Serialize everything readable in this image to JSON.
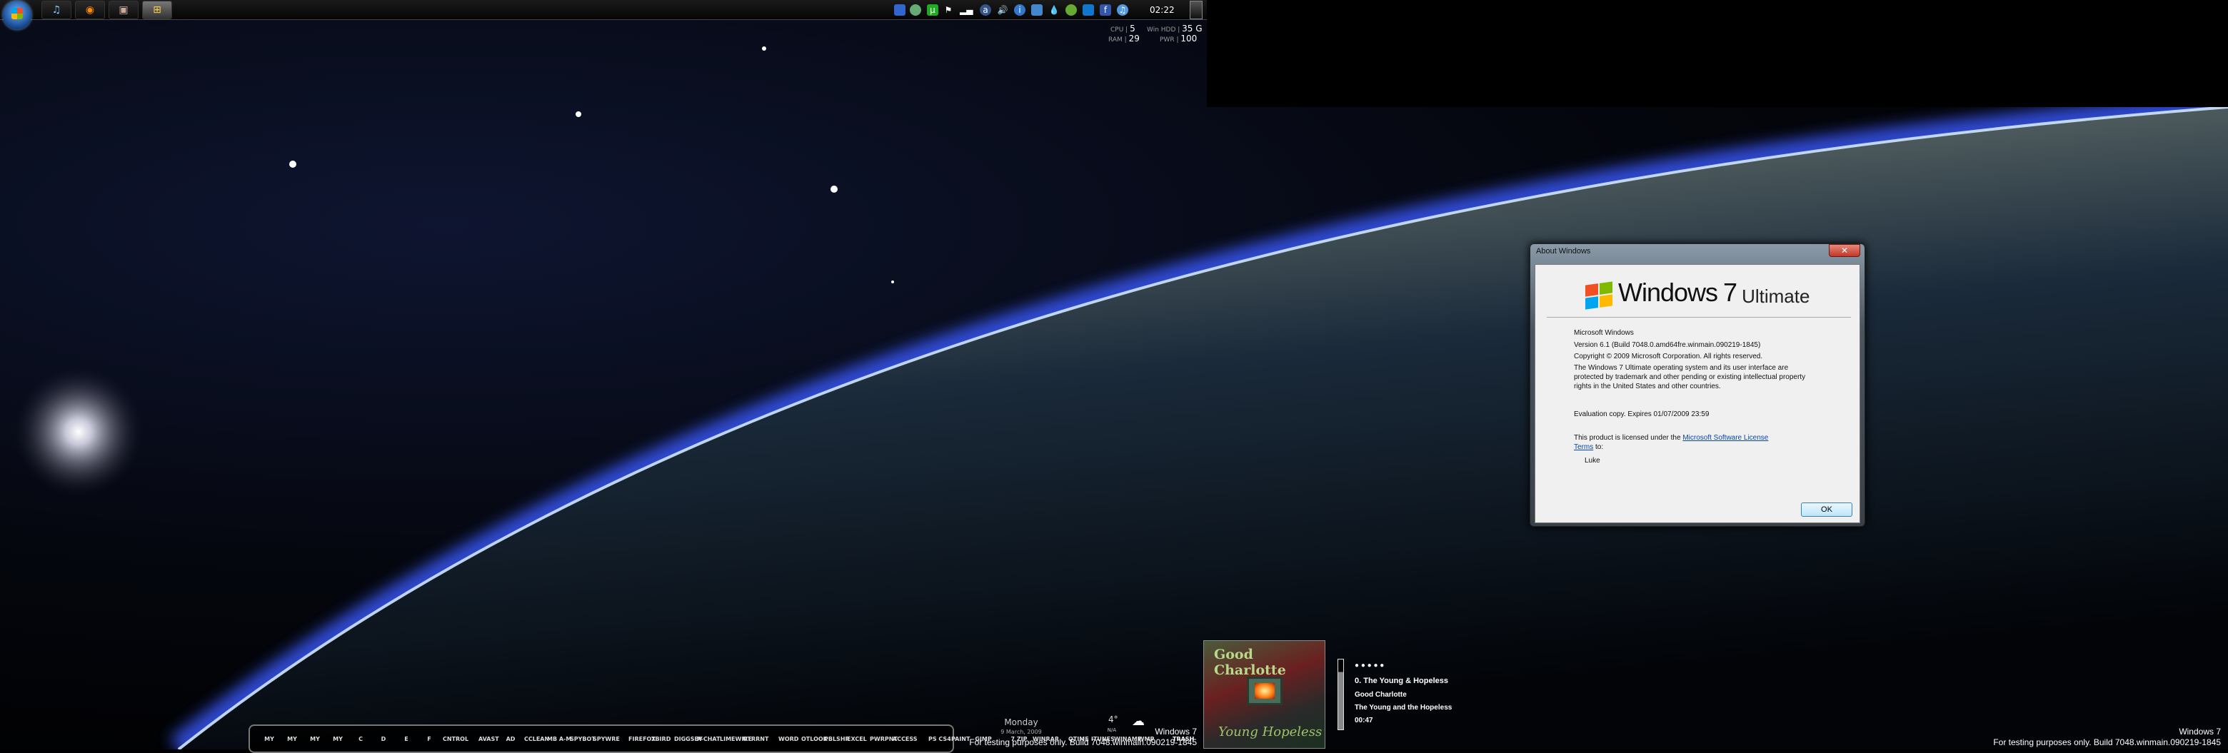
{
  "taskbar": {
    "start_label": "Start",
    "tasks": [
      {
        "name": "itunes",
        "icon": "♫"
      },
      {
        "name": "firefox",
        "icon": "◉"
      },
      {
        "name": "user-picture",
        "icon": "▣"
      },
      {
        "name": "windows-explorer",
        "icon": "⊞"
      }
    ],
    "tray_icons": [
      "network-window",
      "security-shield",
      "utorrent",
      "action-center-flag",
      "signal-bars",
      "avast",
      "volume",
      "info",
      "display",
      "water-drop",
      "game",
      "myspace",
      "facebook",
      "itunes"
    ],
    "clock": "02:22"
  },
  "stats": {
    "cpu_label": "CPU",
    "cpu": "5",
    "ram_label": "RAM",
    "ram": "29",
    "hdd_label": "Win HDD",
    "hdd": "35 G",
    "pwr_label": "PWR",
    "pwr": "100"
  },
  "dialog": {
    "title": "About Windows",
    "close": "✕",
    "logo_windows": "Windows",
    "logo_7": "7",
    "logo_edition": "Ultimate",
    "product": "Microsoft Windows",
    "version": "Version 6.1 (Build 7048.0.amd64fre.winmain.090219-1845)",
    "copyright": "Copyright © 2009 Microsoft Corporation.  All rights reserved.",
    "legal1": "The Windows 7 Ultimate operating system and its user interface are",
    "legal2": "protected by trademark and other pending or existing intellectual property",
    "legal3": "rights in the United States and other countries.",
    "eval": "Evaluation copy. Expires 01/07/2009 23:59",
    "license_pre": "This product is licensed under the ",
    "license_link1": "Microsoft Software License",
    "license_link2": "Terms",
    "license_post": " to:",
    "user": "Luke",
    "ok": "OK"
  },
  "dock": {
    "groups": [
      [
        "MY",
        "MY",
        "MY",
        "MY",
        "C",
        "D",
        "E",
        "F",
        "CNTROL"
      ],
      [
        "AVAST",
        "AD",
        "CCLEAN",
        "MB A-M",
        "SPYBOT",
        "SPYWRE"
      ],
      [
        "FIREFOX",
        "TBIRD",
        "DIGGSBY",
        "X-CHAT",
        "LIMEWIRE",
        "UTRRNT"
      ],
      [
        "WORD",
        "OTLOOK",
        "PBLSHR",
        "EXCEL",
        "PWRPNT",
        "ACCESS"
      ],
      [
        "PS CS4",
        "PAINT",
        "GIMP"
      ],
      [
        "7 ZIP",
        "WINRAR"
      ],
      [
        "QTIME",
        "ITUNES",
        "WINAMP",
        "WMP"
      ],
      [
        "TRASH"
      ]
    ]
  },
  "date": {
    "day": "Monday",
    "date": "9 March, 2009"
  },
  "weather": {
    "temp": "4°",
    "cond": "N/A"
  },
  "watermark": {
    "title": "Windows 7",
    "build": "For testing purposes only. Build 7048.winmain.090219-1845"
  },
  "media": {
    "rating": "● ● ● ● ●",
    "track": "0. The Young & Hopeless",
    "artist": "Good Charlotte",
    "album": "The Young and the Hopeless",
    "time": "00:47",
    "art_band": "Good Charlotte",
    "art_title": "Young Hopeless",
    "volume_percent": 82
  }
}
